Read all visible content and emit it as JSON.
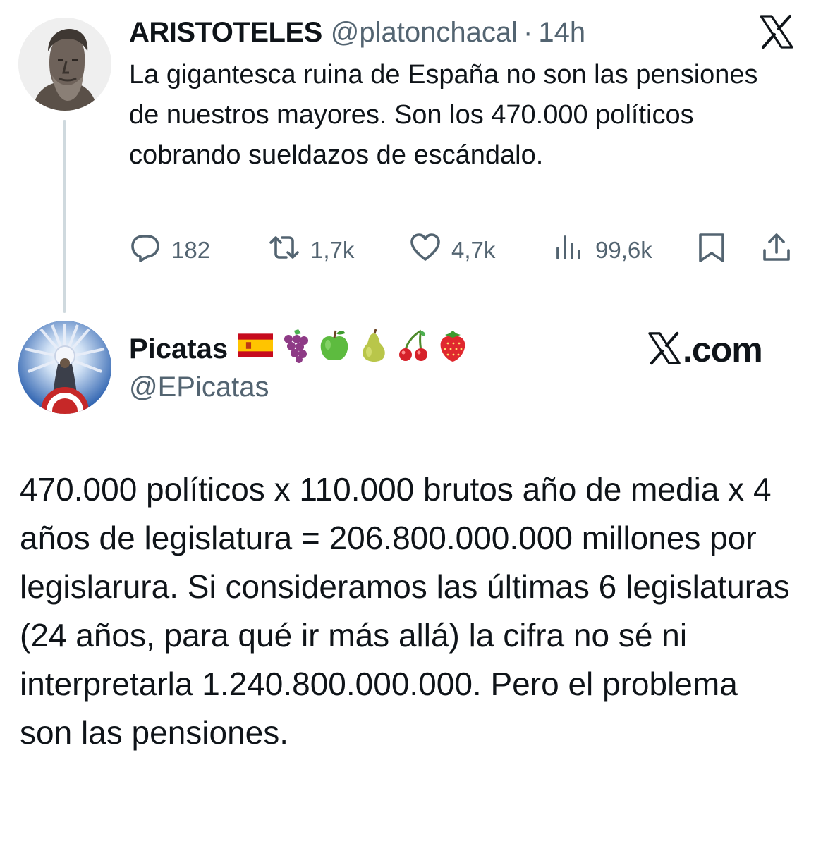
{
  "tweet1": {
    "author_name": "ARISTOTELES",
    "handle": "@platonchacal",
    "separator": "·",
    "time": "14h",
    "text": "La gigantesca ruina de España no son las pensiones de nuestros mayores. Son los 470.000 políticos cobrando sueldazos de escándalo.",
    "stats": {
      "replies": "182",
      "retweets": "1,7k",
      "likes": "4,7k",
      "views": "99,6k"
    }
  },
  "tweet2": {
    "author_name": "Picatas",
    "name_emojis": [
      "spain-flag",
      "grapes",
      "green-apple",
      "pear",
      "cherries",
      "strawberry"
    ],
    "handle": "@EPicatas",
    "text": "470.000 políticos x 110.000 brutos año de media x 4 años de legislatura = 206.800.000.000 millones por legislarura. Si consideramos las últimas 6 legislaturas (24 años, para qué ir más allá) la cifra no sé ni interpretarla 1.240.800.000.000. Pero el problema son las pensiones."
  },
  "watermark": {
    "text": ".com"
  },
  "icons": {
    "top_right": "x-logo-icon",
    "reply": "comment-icon",
    "retweet": "retweet-icon",
    "like": "heart-icon",
    "views": "views-icon",
    "bookmark": "bookmark-icon",
    "share": "share-icon"
  },
  "colors": {
    "text": "#0f1419",
    "secondary": "#536471",
    "thread_line": "#cfd9de"
  }
}
